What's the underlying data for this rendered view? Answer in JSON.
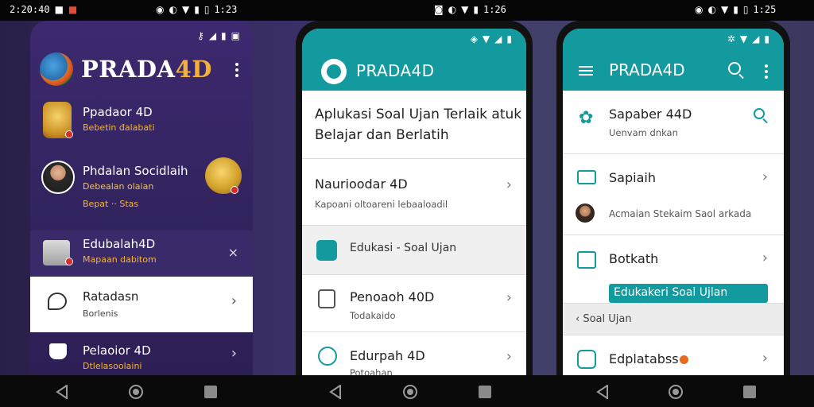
{
  "system_bar": {
    "left_time": "2:20:40",
    "mid_time": "1:23",
    "mid2_time": "1:26",
    "right_time": "1:25"
  },
  "panel1": {
    "title_main": "PRADA",
    "title_accent": "4D",
    "items": [
      {
        "title": "Ppadaor 4D",
        "subtitle": "Bebetin đalabati"
      },
      {
        "title": "Phdalan Socidlaih",
        "subtitle": "Debealan olaian",
        "extra": "Bepat ·· Stas"
      },
      {
        "title": "Edubalah4D",
        "subtitle": "Mapaan dabitom",
        "close": "×"
      },
      {
        "title": "Ratadasn",
        "subtitle": "Borlenis"
      },
      {
        "title": "Pelaoior 4D",
        "subtitle": "Dtlelasoolaini"
      }
    ]
  },
  "panel2": {
    "title": "PRADA4D",
    "intro_line1": "Aplukasi Soal Ujan Terlaik atuk",
    "intro_line2": "Belajar dan Berlatih",
    "items": [
      {
        "title": "Naurioodar 4D",
        "subtitle": "Kapoani oltoareni lebaaloadil"
      },
      {
        "title": "Edukasi - Soal Ujan",
        "subtitle": ""
      },
      {
        "title": "Penoaoh 40D",
        "subtitle": "Todakaido"
      },
      {
        "title": "Edurpah 4D",
        "subtitle": "Potoahan"
      }
    ]
  },
  "panel3": {
    "title": "PRADA4D",
    "items": [
      {
        "title": "Sapaber 44D",
        "subtitle": "Uenvam dnkan"
      },
      {
        "title": "Sapiaih",
        "subtitle": "Acmaian Stekaim Saol arkada"
      },
      {
        "title": "Botkath",
        "chip": "Edukakeri Soal Ujlan"
      },
      {
        "section": "‹ Soal Ujan"
      },
      {
        "title": "Edplatabss"
      }
    ]
  }
}
